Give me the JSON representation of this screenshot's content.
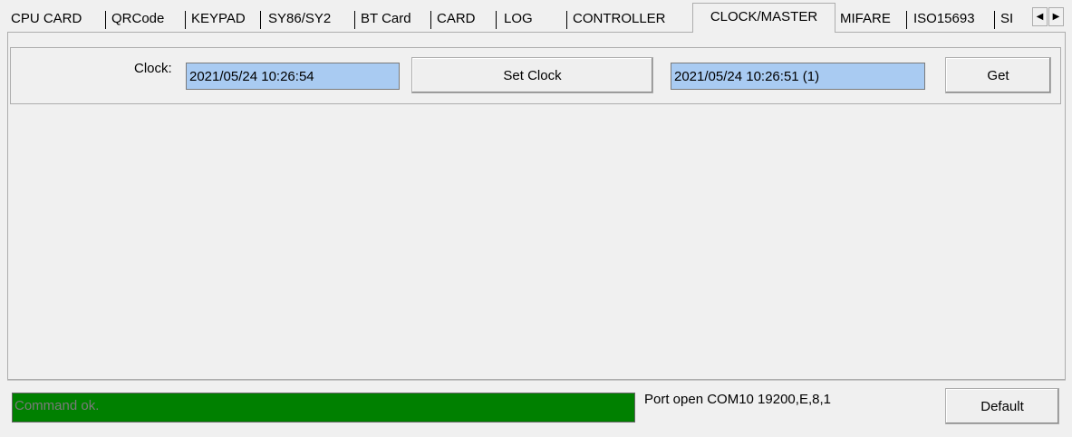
{
  "tabs": [
    {
      "label": "CPU CARD"
    },
    {
      "label": "QRCode"
    },
    {
      "label": "KEYPAD"
    },
    {
      "label": "SY86/SY2"
    },
    {
      "label": "BT Card"
    },
    {
      "label": "CARD"
    },
    {
      "label": "LOG"
    },
    {
      "label": "CONTROLLER"
    },
    {
      "label": "CLOCK/MASTER"
    },
    {
      "label": "MIFARE"
    },
    {
      "label": "ISO15693"
    },
    {
      "label": "SI"
    }
  ],
  "active_tab": "CLOCK/MASTER",
  "scroll": {
    "left": "◀",
    "right": "▶"
  },
  "clock": {
    "label": "Clock:",
    "value": "2021/05/24 10:26:54",
    "set_button": "Set Clock",
    "result_value": "2021/05/24 10:26:51 (1)",
    "get_button": "Get"
  },
  "status": {
    "message": "Command ok.",
    "color": "#008000",
    "port": "Port open COM10 19200,E,8,1",
    "default_button": "Default"
  }
}
